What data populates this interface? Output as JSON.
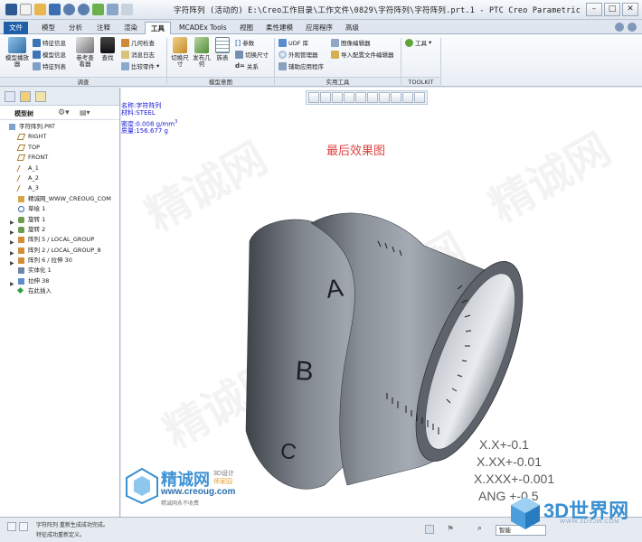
{
  "window": {
    "title": "字符阵列 (活动的) E:\\Creo工作目录\\工作文件\\0829\\字符阵列\\字符阵列.prt.1 - PTC Creo Parametric 3.0",
    "controls": [
      "–",
      "□",
      "✕"
    ]
  },
  "tabs": [
    "文件",
    "模型",
    "分析",
    "注释",
    "渲染",
    "工具",
    "MCADEx Tools",
    "视图",
    "柔性建模",
    "应用程序",
    "高级"
  ],
  "active_tab": "工具",
  "ribbon": {
    "investigate": {
      "big_model_player": "模型播放器",
      "feature_info": "特征信息",
      "model_info": "模型信息",
      "feature_list": "特征列表",
      "ref_viewer": "参考查看器",
      "find": "查找",
      "geometry_check": "几何检查",
      "message_log": "消息日志",
      "compare_part": "比较零件"
    },
    "model_intent": {
      "switch_dims": "切换尺寸",
      "publish_geom": "发布几何",
      "family_table": "族表",
      "params": "参数",
      "toggle_dims": "切换尺寸",
      "relations": "关系",
      "d_sym": "d="
    },
    "utilities": {
      "udf_lib": "UDF 库",
      "aux_app": "辅助应用程序",
      "ext_manager": "外观管理器",
      "image_editor": "图像编辑器",
      "import_config": "导入配置文件编辑器"
    },
    "toolkit": {
      "tools": "工具"
    },
    "groups": {
      "investigate": "调查",
      "model_intent": "模型意图",
      "utilities": "实用工具",
      "toolkit": "TOOLKIT"
    }
  },
  "left_panel": {
    "header": "模型树",
    "tree": [
      {
        "label": "字符阵列.PRT",
        "icon": "part-icon",
        "indent": 0,
        "expander": ""
      },
      {
        "label": "RIGHT",
        "icon": "datum-plane-icon",
        "indent": 1,
        "expander": ""
      },
      {
        "label": "TOP",
        "icon": "datum-plane-icon",
        "indent": 1,
        "expander": ""
      },
      {
        "label": "FRONT",
        "icon": "datum-plane-icon",
        "indent": 1,
        "expander": ""
      },
      {
        "label": "A_1",
        "icon": "axis-icon",
        "indent": 1,
        "expander": ""
      },
      {
        "label": "A_2",
        "icon": "axis-icon",
        "indent": 1,
        "expander": ""
      },
      {
        "label": "A_3",
        "icon": "axis-icon",
        "indent": 1,
        "expander": ""
      },
      {
        "label": "精诚网_WWW_CREOUG_COM",
        "icon": "note-icon",
        "indent": 1,
        "expander": ""
      },
      {
        "label": "草绘 1",
        "icon": "sketch-icon",
        "indent": 1,
        "expander": ""
      },
      {
        "label": "旋转 1",
        "icon": "revolve-icon",
        "indent": 1,
        "expander": "▶"
      },
      {
        "label": "旋转 2",
        "icon": "revolve-icon",
        "indent": 1,
        "expander": "▶"
      },
      {
        "label": "阵列 5 / LOCAL_GROUP",
        "icon": "pattern-icon",
        "indent": 1,
        "expander": "▶"
      },
      {
        "label": "阵列 2 / LOCAL_GROUP_8",
        "icon": "pattern-icon",
        "indent": 1,
        "expander": "▶"
      },
      {
        "label": "阵列 6 / 拉伸 30",
        "icon": "pattern-icon",
        "indent": 1,
        "expander": "▶"
      },
      {
        "label": "实体化 1",
        "icon": "solidify-icon",
        "indent": 1,
        "expander": ""
      },
      {
        "label": "拉伸 38",
        "icon": "extrude-icon",
        "indent": 1,
        "expander": "▶"
      },
      {
        "label": "在此插入",
        "icon": "insert-here-icon",
        "indent": 1,
        "expander": ""
      }
    ]
  },
  "graphics": {
    "mass_props": {
      "name": "名称:字符阵列",
      "material": "材料:STEEL",
      "density": "密度:0.008 g/mm",
      "density_sup": "3",
      "mass": "质量:156.677 g"
    },
    "caption": "最后效果图",
    "letters": [
      "A",
      "B",
      "C"
    ],
    "tolerances": [
      "X.X+-0.1",
      "X.XX+-0.01",
      "X.XXX+-0.001",
      "ANG +-0.5"
    ],
    "watermark": {
      "brand": "精诚网",
      "sub1": "3D设计",
      "sub2": "师家园",
      "url": "www.creoug.com",
      "slogan": "精诚网永不收费"
    },
    "logo_3dsj": {
      "title": "3D世界网",
      "url": "WWW.3DSJW.COM"
    }
  },
  "status": {
    "messages": [
      "字符阵列 重新生成成功完成。",
      "特征成功重新定义。"
    ],
    "select_filter": "智能"
  },
  "colors": {
    "accent": "#1c4f93",
    "caption": "#e04040",
    "mass_text": "#1a1ad8",
    "part_steel": "#6f747c"
  }
}
